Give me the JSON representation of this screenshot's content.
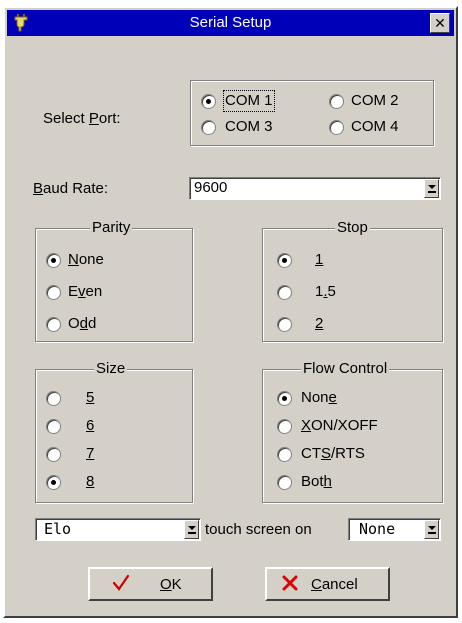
{
  "window": {
    "title": "Serial Setup",
    "icons": {
      "app": "plug-icon",
      "close": "close-icon"
    },
    "close_glyph": "✕"
  },
  "port": {
    "label_pre": "Select ",
    "label_mnemonic": "P",
    "label_post": "ort:",
    "options": [
      "COM 1",
      "COM 2",
      "COM 3",
      "COM 4"
    ],
    "selected": "COM 1"
  },
  "baud": {
    "label_mnemonic": "B",
    "label_post": "aud Rate:",
    "value": "9600"
  },
  "parity": {
    "title": "Parity",
    "options": [
      {
        "pre": "",
        "mn": "N",
        "post": "one"
      },
      {
        "pre": "E",
        "mn": "v",
        "post": "en"
      },
      {
        "pre": "O",
        "mn": "d",
        "post": "d"
      }
    ],
    "selected": "None"
  },
  "stop": {
    "title": "Stop",
    "options": [
      {
        "pre": "",
        "mn": "1",
        "post": ""
      },
      {
        "pre": "1",
        "mn": ".",
        "post": "5"
      },
      {
        "pre": "",
        "mn": "2",
        "post": ""
      }
    ],
    "selected": "1"
  },
  "size": {
    "title": "Size",
    "options": [
      {
        "pre": "",
        "mn": "5",
        "post": ""
      },
      {
        "pre": "",
        "mn": "6",
        "post": ""
      },
      {
        "pre": "",
        "mn": "7",
        "post": ""
      },
      {
        "pre": "",
        "mn": "8",
        "post": ""
      }
    ],
    "selected": "8"
  },
  "flow": {
    "title": "Flow Control",
    "options": [
      {
        "pre": "Non",
        "mn": "e",
        "post": ""
      },
      {
        "pre": "",
        "mn": "X",
        "post": "ON/XOFF"
      },
      {
        "pre": "CT",
        "mn": "S",
        "post": "/RTS"
      },
      {
        "pre": "Bot",
        "mn": "h",
        "post": ""
      }
    ],
    "selected": "None"
  },
  "touch": {
    "device": "Elo",
    "mid_text": "touch screen on",
    "port": "None"
  },
  "buttons": {
    "ok": {
      "mn": "O",
      "post": "K",
      "icon": "checkmark-icon",
      "icon_color": "#cc0000"
    },
    "cancel": {
      "mn": "C",
      "post": "ancel",
      "icon": "x-mark-icon",
      "icon_color": "#dd0000"
    }
  }
}
